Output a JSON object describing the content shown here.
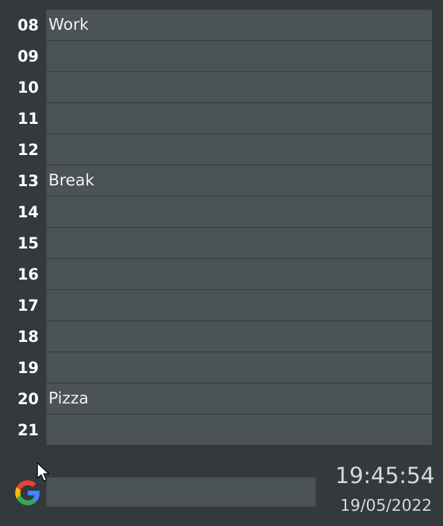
{
  "planner": {
    "rows": [
      {
        "hour": "08",
        "entry": "Work"
      },
      {
        "hour": "09",
        "entry": ""
      },
      {
        "hour": "10",
        "entry": ""
      },
      {
        "hour": "11",
        "entry": ""
      },
      {
        "hour": "12",
        "entry": ""
      },
      {
        "hour": "13",
        "entry": "Break"
      },
      {
        "hour": "14",
        "entry": ""
      },
      {
        "hour": "15",
        "entry": ""
      },
      {
        "hour": "16",
        "entry": ""
      },
      {
        "hour": "17",
        "entry": ""
      },
      {
        "hour": "18",
        "entry": ""
      },
      {
        "hour": "19",
        "entry": ""
      },
      {
        "hour": "20",
        "entry": "Pizza"
      },
      {
        "hour": "21",
        "entry": ""
      }
    ]
  },
  "search": {
    "icon": "google-g-icon",
    "value": ""
  },
  "clock": {
    "time": "19:45:54",
    "date": "19/05/2022"
  },
  "colors": {
    "background": "#33393c",
    "slot": "#4b5355",
    "text": "#ffffff",
    "clock_text": "#d8d8d8"
  }
}
